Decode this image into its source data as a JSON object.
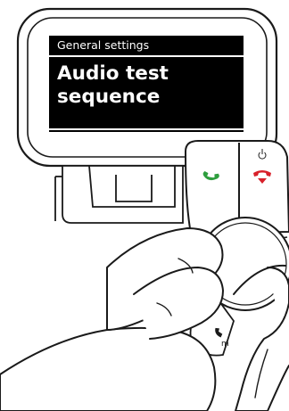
{
  "device": {
    "screen": {
      "header": "General settings",
      "body_line1": "Audio test",
      "body_line2": "sequence"
    },
    "buttons": {
      "call_color": "#2e9e3e",
      "hangup_color": "#d8202a"
    },
    "icons": [
      "call-icon",
      "hangup-icon",
      "power-icon",
      "phone-handset-icon"
    ]
  }
}
